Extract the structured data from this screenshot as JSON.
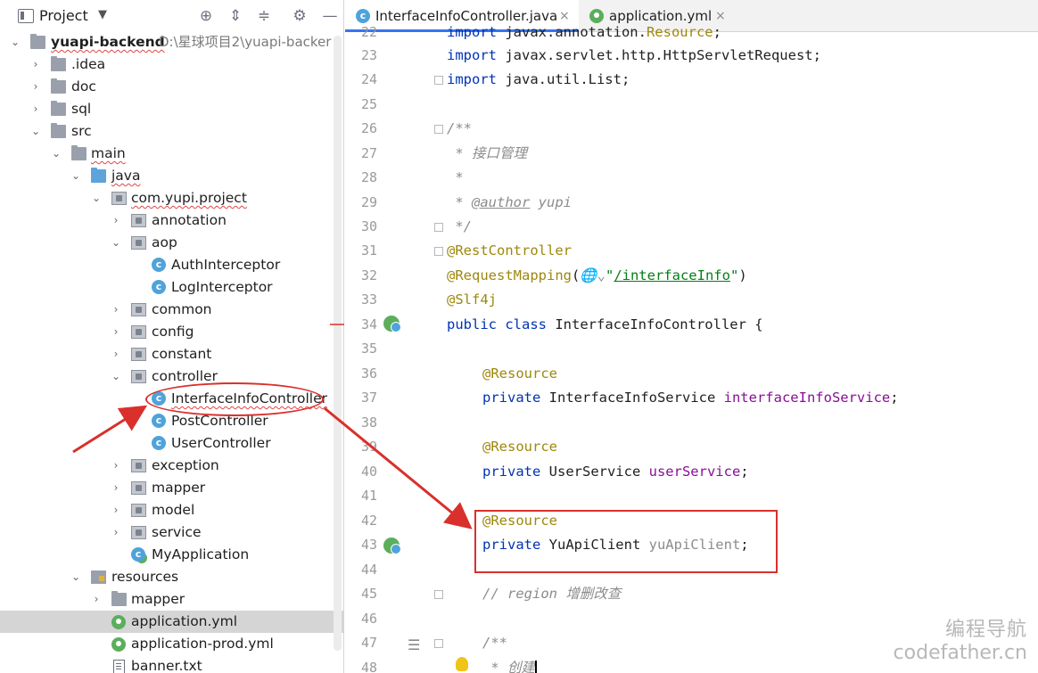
{
  "project_panel": {
    "title": "Project",
    "dropdown": "▼",
    "toolbar_icons": [
      "target-icon",
      "expand-all-icon",
      "collapse-all-icon",
      "gear-icon",
      "minimize-icon"
    ],
    "root": {
      "name": "yuapi-backend",
      "path": "D:\\星球项目2\\yuapi-backer"
    },
    "items": [
      {
        "label": "annotation"
      },
      {
        "label": "aop"
      }
    ],
    "tree": {
      "idea": ".idea",
      "doc": "doc",
      "sql": "sql",
      "src": "src",
      "main": "main",
      "java": "java",
      "pkg": "com.yupi.project",
      "annotation": "annotation",
      "aop": "aop",
      "auth": "AuthInterceptor",
      "log": "LogInterceptor",
      "common": "common",
      "config": "config",
      "constant": "constant",
      "controller": "controller",
      "iic": "InterfaceInfoController",
      "post": "PostController",
      "user": "UserController",
      "exception": "exception",
      "mapper": "mapper",
      "model": "model",
      "service": "service",
      "myapp": "MyApplication",
      "resources": "resources",
      "res_mapper": "mapper",
      "app_yml": "application.yml",
      "app_prod": "application-prod.yml",
      "banner": "banner.txt"
    }
  },
  "editor": {
    "tabs": [
      {
        "label": "InterfaceInfoController.java",
        "active": true
      },
      {
        "label": "application.yml",
        "active": false
      }
    ],
    "close_glyph": "×",
    "line_numbers": [
      "22",
      "23",
      "24",
      "25",
      "26",
      "27",
      "28",
      "29",
      "30",
      "31",
      "32",
      "33",
      "34",
      "35",
      "36",
      "37",
      "38",
      "39",
      "40",
      "41",
      "42",
      "43",
      "44",
      "45",
      "46",
      "47",
      "48"
    ],
    "code": {
      "l22_a": "import ",
      "l22_b": "javax.annotation.",
      "l22_c": "Resource",
      "l22_d": ";",
      "l23_a": "import ",
      "l23_b": "javax.servlet.http.HttpServletRequest;",
      "l24_a": "import ",
      "l24_b": "java.util.List;",
      "l26": "/**",
      "l27": " * 接口管理",
      "l28": " *",
      "l29_a": " * ",
      "l29_b": "@author",
      "l29_c": " yupi",
      "l30": " */",
      "l31": "@RestController",
      "l32_a": "@RequestMapping",
      "l32_b": "(",
      "l32_c": "🌐⌄",
      "l32_d": "\"",
      "l32_e": "/interfaceInfo",
      "l32_f": "\"",
      "l32_g": ")",
      "l33": "@Slf4j",
      "l34_a": "public class ",
      "l34_b": "InterfaceInfoController {",
      "l36": "@Resource",
      "l37_a": "private ",
      "l37_b": "InterfaceInfoService ",
      "l37_c": "interfaceInfoService",
      "l37_d": ";",
      "l39": "@Resource",
      "l40_a": "private ",
      "l40_b": "UserService ",
      "l40_c": "userService",
      "l40_d": ";",
      "l42": "@Resource",
      "l43_a": "private ",
      "l43_b": "YuApiClient ",
      "l43_c": "yuApiClient",
      "l43_d": ";",
      "l45_a": "// region ",
      "l45_b": "增删改查",
      "l47": "/**",
      "l48": " * 创建"
    }
  },
  "watermark": {
    "line1": "编程导航",
    "line2": "codefather.cn"
  },
  "colors": {
    "highlight": "#d9302c",
    "keyword": "#0033b3",
    "annotation": "#9e880d",
    "field": "#871094",
    "tab_accent": "#3574f0"
  }
}
